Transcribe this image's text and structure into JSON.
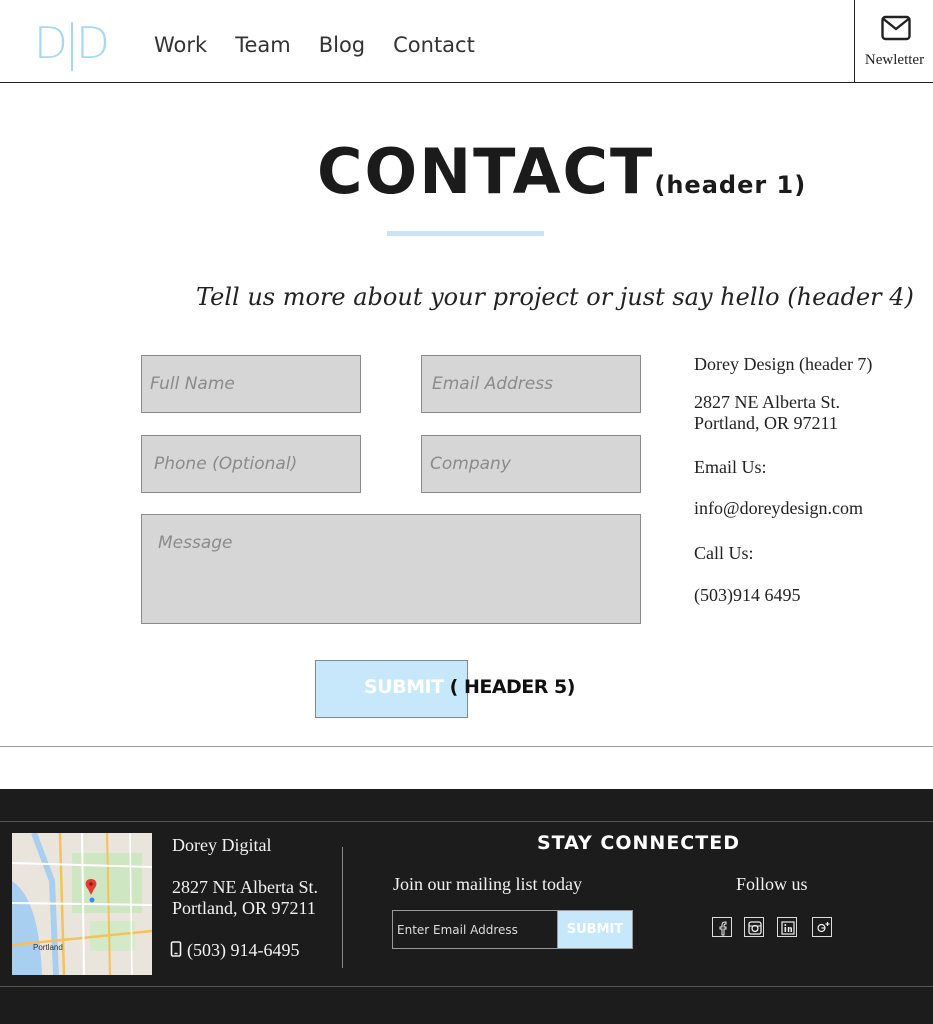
{
  "header": {
    "logo_text": "D|D",
    "logo_color": "#a8d8ee",
    "nav": [
      {
        "label": "Work"
      },
      {
        "label": "Team"
      },
      {
        "label": "Blog"
      },
      {
        "label": "Contact"
      }
    ],
    "newsletter_label": "Newletter",
    "newsletter_icon": "envelope-icon"
  },
  "main": {
    "title": "CONTACT",
    "title_note": "(header 1)",
    "subtitle": "Tell us more about your project or just say hello (header 4)",
    "accent_color": "#c7e6f5",
    "form": {
      "full_name_placeholder": "Full Name",
      "email_placeholder": "Email Address",
      "phone_placeholder": "Phone (Optional)",
      "company_placeholder": "Company",
      "message_placeholder": "Message",
      "submit_label": "SUBMIT",
      "submit_note": " ( HEADER 5)"
    },
    "contact_info": {
      "company": "Dorey Design (header 7)",
      "address_line1": "2827 NE Alberta St.",
      "address_line2": "Portland, OR 97211",
      "email_label": "Email Us:",
      "email": "info@doreydesign.com",
      "call_label": "Call Us:",
      "phone": "(503)914 6495"
    }
  },
  "footer": {
    "company": "Dorey Digital",
    "address_line1": "2827 NE Alberta St.",
    "address_line2": "Portland, OR 97211",
    "phone": "(503) 914-6495",
    "phone_icon": "mobile-phone-icon",
    "map_label": "Portland",
    "stay_connected": "STAY CONNECTED",
    "mailing_label": "Join our mailing list today",
    "email_placeholder": "Enter Email Address",
    "submit_label": "SUBMIT",
    "follow_label": "Follow us",
    "social": [
      "facebook-icon",
      "instagram-icon",
      "linkedin-icon",
      "google-plus-icon"
    ],
    "background_color": "#1c1c1c"
  }
}
